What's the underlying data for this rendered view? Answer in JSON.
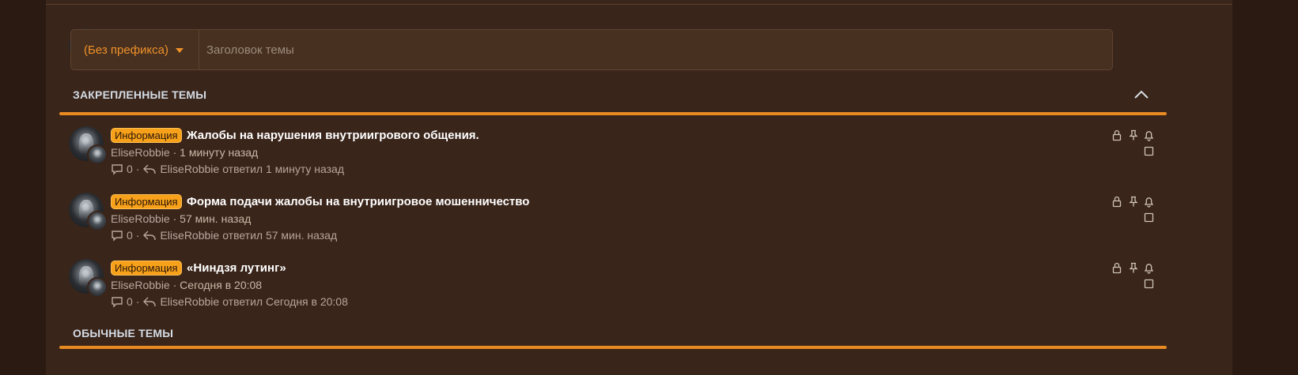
{
  "new_thread": {
    "prefix_label": "(Без префикса)",
    "title_placeholder": "Заголовок темы"
  },
  "sections": {
    "pinned_title": "ЗАКРЕПЛЕННЫЕ ТЕМЫ",
    "normal_title": "ОБЫЧНЫЕ ТЕМЫ"
  },
  "threads": [
    {
      "prefix": "Информация",
      "title": "Жалобы на нарушения внутриигрового общения.",
      "author": "EliseRobbie",
      "sep": "·",
      "time": "1 минуту назад",
      "replies": "0",
      "last_poster": "EliseRobbie",
      "last_text": "ответил 1 минуту назад"
    },
    {
      "prefix": "Информация",
      "title": "Форма подачи жалобы на внутриигровое мошенничество",
      "author": "EliseRobbie",
      "sep": "·",
      "time": "57 мин. назад",
      "replies": "0",
      "last_poster": "EliseRobbie",
      "last_text": "ответил 57 мин. назад"
    },
    {
      "prefix": "Информация",
      "title": "«Ниндзя лутинг»",
      "author": "EliseRobbie",
      "sep": "·",
      "time": "Сегодня в 20:08",
      "replies": "0",
      "last_poster": "EliseRobbie",
      "last_text": "ответил Сегодня в 20:08"
    }
  ],
  "colors": {
    "accent": "#e88a22",
    "prefix_badge": "#f7a11a",
    "panel": "#3a251a",
    "background": "#2b1a11"
  },
  "icons": [
    "avatar",
    "chevron-up-icon",
    "lock-icon",
    "pin-icon",
    "bell-icon",
    "checkbox",
    "comment-icon",
    "reply-icon",
    "caret-down-icon"
  ]
}
